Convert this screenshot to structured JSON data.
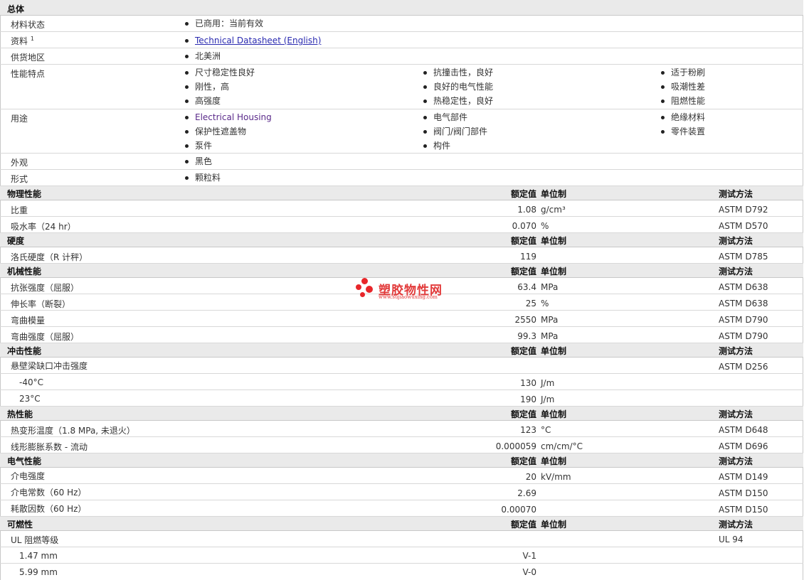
{
  "general": {
    "header": "总体",
    "status": {
      "label": "材料状态",
      "value": "已商用：当前有效"
    },
    "docs": {
      "label": "资料",
      "sup": "1",
      "link": "Technical Datasheet (English)"
    },
    "region": {
      "label": "供货地区",
      "value": "北美洲"
    },
    "features": {
      "label": "性能特点",
      "col1": [
        "尺寸稳定性良好",
        "刚性，高",
        "高强度"
      ],
      "col2": [
        "抗撞击性，良好",
        "良好的电气性能",
        "热稳定性，良好"
      ],
      "col3": [
        "适于粉刷",
        "吸潮性差",
        "阻燃性能"
      ]
    },
    "uses": {
      "label": "用途",
      "col1": [
        "Electrical Housing",
        "保护性遮盖物",
        "泵件"
      ],
      "col2": [
        "电气部件",
        "阀门/阀门部件",
        "构件"
      ],
      "col3": [
        "绝缘材料",
        "零件装置"
      ]
    },
    "appearance": {
      "label": "外观",
      "value": "黑色"
    },
    "form": {
      "label": "形式",
      "value": "颗粒料"
    }
  },
  "columns": {
    "nominal": "额定值",
    "unit": "单位制",
    "method": "测试方法"
  },
  "physical": {
    "header": "物理性能",
    "rows": [
      {
        "name": "比重",
        "value": "1.08",
        "unit": "g/cm³",
        "method": "ASTM D792"
      },
      {
        "name": "吸水率（24 hr）",
        "value": "0.070",
        "unit": "%",
        "method": "ASTM D570"
      }
    ]
  },
  "hardness": {
    "header": "硬度",
    "rows": [
      {
        "name": "洛氏硬度（R 计秤）",
        "value": "119",
        "unit": "",
        "method": "ASTM D785"
      }
    ]
  },
  "mechanical": {
    "header": "机械性能",
    "rows": [
      {
        "name": "抗张强度（屈服）",
        "value": "63.4",
        "unit": "MPa",
        "method": "ASTM D638"
      },
      {
        "name": "伸长率（断裂）",
        "value": "25",
        "unit": "%",
        "method": "ASTM D638"
      },
      {
        "name": "弯曲模量",
        "value": "2550",
        "unit": "MPa",
        "method": "ASTM D790"
      },
      {
        "name": "弯曲强度（屈服）",
        "value": "99.3",
        "unit": "MPa",
        "method": "ASTM D790"
      }
    ]
  },
  "impact": {
    "header": "冲击性能",
    "rows": [
      {
        "name": "悬壁梁缺口冲击强度",
        "value": "",
        "unit": "",
        "method": "ASTM D256"
      },
      {
        "name": "-40°C",
        "value": "130",
        "unit": "J/m",
        "method": ""
      },
      {
        "name": "23°C",
        "value": "190",
        "unit": "J/m",
        "method": ""
      }
    ]
  },
  "thermal": {
    "header": "热性能",
    "rows": [
      {
        "name": "热变形温度（1.8 MPa, 未退火）",
        "value": "123",
        "unit": "°C",
        "method": "ASTM D648"
      },
      {
        "name": "线形膨胀系数 - 流动",
        "value": "0.000059",
        "unit": "cm/cm/°C",
        "method": "ASTM D696"
      }
    ]
  },
  "electrical": {
    "header": "电气性能",
    "rows": [
      {
        "name": "介电强度",
        "value": "20",
        "unit": "kV/mm",
        "method": "ASTM D149"
      },
      {
        "name": "介电常数（60 Hz）",
        "value": "2.69",
        "unit": "",
        "method": "ASTM D150"
      },
      {
        "name": "耗散因数（60 Hz）",
        "value": "0.00070",
        "unit": "",
        "method": "ASTM D150"
      }
    ]
  },
  "flammability": {
    "header": "可燃性",
    "rows": [
      {
        "name": "UL 阻燃等级",
        "value": "",
        "unit": "",
        "method": "UL 94"
      },
      {
        "name": "1.47 mm",
        "value": "V-1",
        "unit": "",
        "method": ""
      },
      {
        "name": "5.99 mm",
        "value": "V-0",
        "unit": "",
        "method": ""
      }
    ]
  },
  "watermark": {
    "name": "塑胶物性网",
    "url": "www.sujiaowuxing.com"
  },
  "colors": {
    "section_bg": "#eaeaea",
    "link": "#2a2ab0",
    "watermark": "#e8262a"
  }
}
